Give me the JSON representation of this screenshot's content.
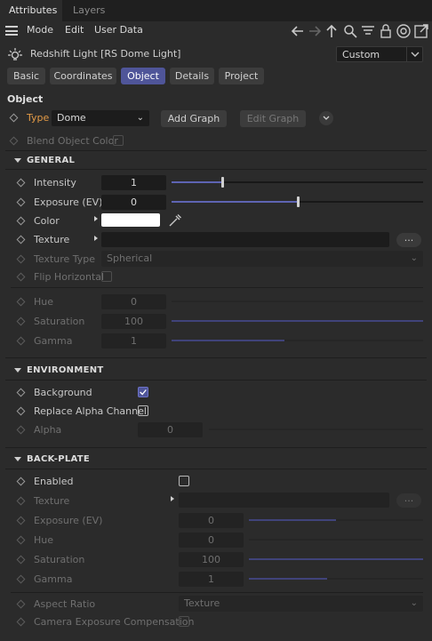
{
  "tabs": {
    "attributes": "Attributes",
    "layers": "Layers"
  },
  "menu": {
    "mode": "Mode",
    "edit": "Edit",
    "user_data": "User Data"
  },
  "toolbar_icons": [
    "arrow-left-icon",
    "arrow-right-icon",
    "arrow-up-icon",
    "search-icon",
    "filter-icon",
    "lock-icon",
    "target-icon",
    "new-window-icon"
  ],
  "object": {
    "title": "Redshift Light [RS Dome Light]",
    "preset": "Custom"
  },
  "subtabs": {
    "basic": "Basic",
    "coordinates": "Coordinates",
    "object": "Object",
    "details": "Details",
    "project": "Project",
    "active": "Object"
  },
  "object_section": {
    "heading": "Object",
    "type_label": "Type",
    "type_value": "Dome",
    "add_graph": "Add Graph",
    "edit_graph": "Edit Graph",
    "blend_label": "Blend Object Color"
  },
  "general": {
    "heading": "GENERAL",
    "intensity_label": "Intensity",
    "intensity_value": "1",
    "intensity_slider": 0.2,
    "exposure_label": "Exposure (EV)",
    "exposure_value": "0",
    "exposure_slider": 0.5,
    "color_label": "Color",
    "color_value": "#ffffff",
    "texture_label": "Texture",
    "texture_button": "...",
    "texture_type_label": "Texture Type",
    "texture_type_value": "Spherical",
    "flip_label": "Flip Horizontal",
    "hue_label": "Hue",
    "hue_value": "0",
    "saturation_label": "Saturation",
    "saturation_value": "100",
    "gamma_label": "Gamma",
    "gamma_value": "1"
  },
  "environment": {
    "heading": "ENVIRONMENT",
    "background_label": "Background",
    "background_checked": true,
    "replace_alpha_label": "Replace Alpha Channel",
    "alpha_label": "Alpha",
    "alpha_value": "0"
  },
  "backplate": {
    "heading": "BACK-PLATE",
    "enabled_label": "Enabled",
    "texture_label": "Texture",
    "texture_button": "...",
    "exposure_label": "Exposure (EV)",
    "exposure_value": "0",
    "hue_label": "Hue",
    "hue_value": "0",
    "saturation_label": "Saturation",
    "saturation_value": "100",
    "gamma_label": "Gamma",
    "gamma_value": "1",
    "aspect_label": "Aspect Ratio",
    "aspect_value": "Texture",
    "camera_comp_label": "Camera Exposure Compensation"
  }
}
